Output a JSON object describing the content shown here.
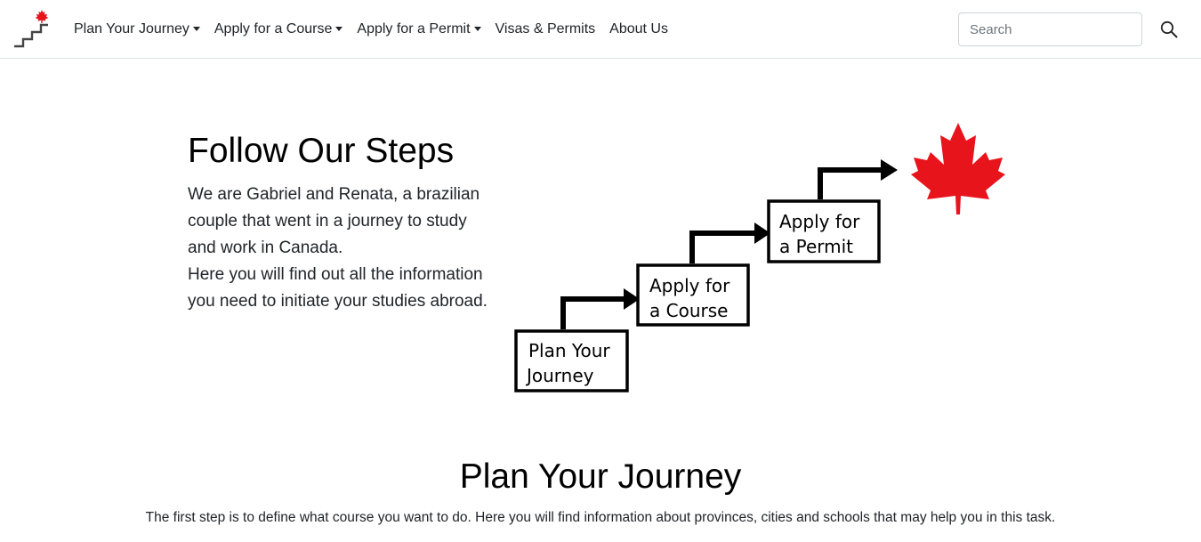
{
  "header": {
    "nav": {
      "plan_journey": "Plan Your Journey",
      "apply_course": "Apply for a Course",
      "apply_permit": "Apply for a Permit",
      "visas_permits": "Visas & Permits",
      "about_us": "About Us"
    },
    "search": {
      "placeholder": "Search",
      "value": ""
    },
    "icons": {
      "logo": "stairs-maple-leaf-logo",
      "search": "search-icon"
    }
  },
  "hero": {
    "title": "Follow Our Steps",
    "paragraph_1": "We are Gabriel and Renata, a brazilian couple that went in a journey to study and work in Canada.",
    "paragraph_2": "Here you will find out all the information you need to initiate your studies abroad."
  },
  "steps_illustration": {
    "step_1": {
      "line_1": "Plan Your",
      "line_2": "Journey"
    },
    "step_2": {
      "line_1": "Apply for",
      "line_2": "a Course"
    },
    "step_3": {
      "line_1": "Apply for",
      "line_2": "a Permit"
    },
    "goal_icon": "maple-leaf-icon"
  },
  "plan_section": {
    "title": "Plan Your Journey",
    "text": "The first step is to define what course you want to do. Here you will find information about provinces, cities and schools that may help you in this task."
  },
  "colors": {
    "accent_red": "#e8141c",
    "text": "#212529",
    "border": "#dee2e6"
  }
}
